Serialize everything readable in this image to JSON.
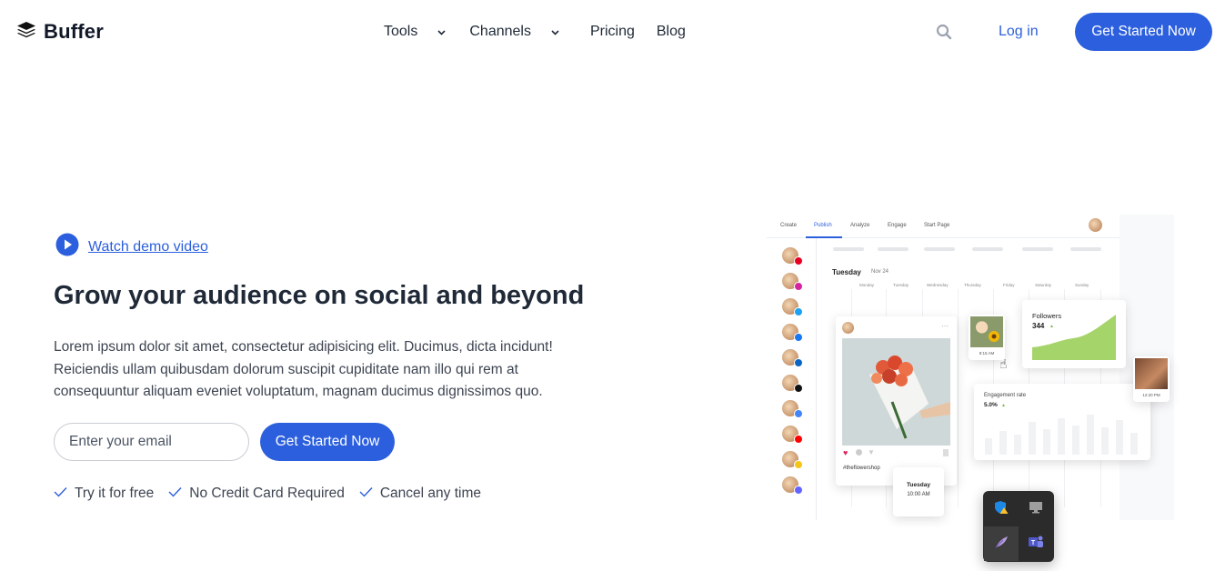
{
  "header": {
    "logo_text": "Buffer",
    "nav": {
      "tools": "Tools",
      "channels": "Channels",
      "pricing": "Pricing",
      "blog": "Blog"
    },
    "login": "Log in",
    "cta": "Get Started Now"
  },
  "hero": {
    "watch_demo": "Watch demo video",
    "title": "Grow your audience on social and beyond",
    "description": "Lorem ipsum dolor sit amet, consectetur adipisicing elit. Ducimus, dicta incidunt! Reiciendis ullam quibusdam dolorum suscipit cupiditate nam illo qui rem at consequuntur aliquam eveniet voluptatum, magnam ducimus dignissimos quo.",
    "email_placeholder": "Enter your email",
    "cta": "Get Started Now",
    "perks": [
      "Try it for free",
      "No Credit Card Required",
      "Cancel any time"
    ]
  },
  "mockup": {
    "tabs": [
      "Create",
      "Publish",
      "Analyze",
      "Engage",
      "Start Page"
    ],
    "active_tab": "Publish",
    "date_day": "Tuesday",
    "date": "Nov 24",
    "weekdays": [
      "Monday",
      "Tuesday",
      "Wednesday",
      "Thursday",
      "Friday",
      "Saturday",
      "Sunday"
    ],
    "post_tag": "#theflowershop",
    "followers_label": "Followers",
    "followers_value": "344",
    "engagement_label": "Engagement rate",
    "engagement_value": "5.0%",
    "thumb1_time": "9:15 AM",
    "thumb2_time": "12:20 PM",
    "schedule_day": "Tuesday",
    "schedule_time": "10:00 AM",
    "channel_badges": [
      "pinterest",
      "instagram",
      "twitter",
      "facebook",
      "linkedin",
      "tiktok",
      "google-business",
      "youtube",
      "start-page",
      "mastodon"
    ]
  },
  "colors": {
    "primary": "#2c5fdd",
    "text": "#1f2937",
    "followers_chart": "#a5d46a"
  }
}
